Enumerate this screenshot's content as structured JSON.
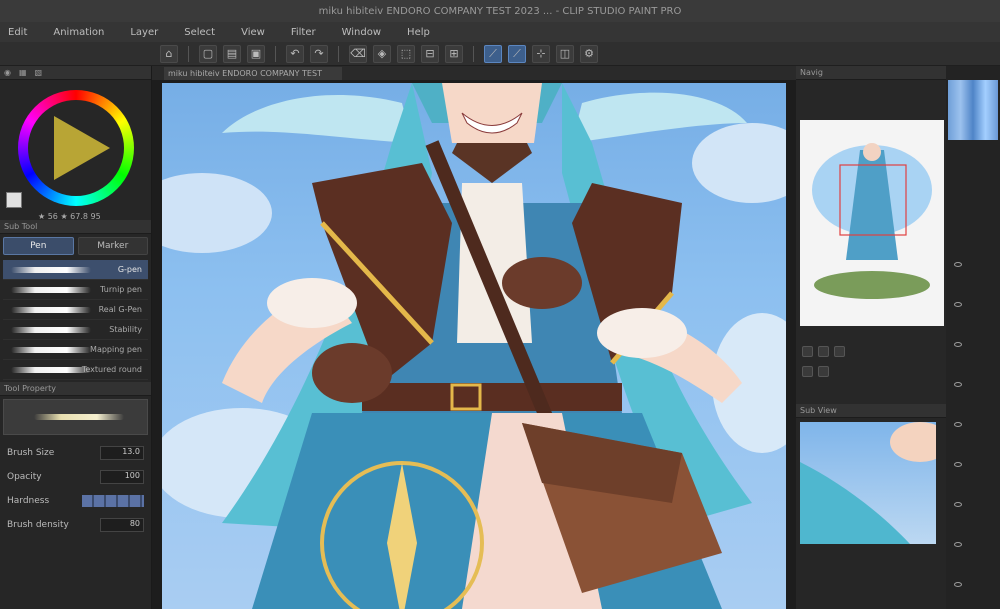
{
  "window": {
    "title": "miku hibiteiv ENDORO COMPANY TEST 2023 ... - CLIP STUDIO PAINT PRO"
  },
  "menu": [
    "Edit",
    "Animation",
    "Layer",
    "Select",
    "View",
    "Filter",
    "Window",
    "Help"
  ],
  "left_panel": {
    "color_hsv": "★ 56 ★ 67.8 95",
    "color_label": "color",
    "subtool_header": "Sub Tool",
    "tabs": {
      "pen": "Pen",
      "marker": "Marker"
    },
    "brushes": [
      "G-pen",
      "Turnip pen",
      "Real G-Pen",
      "Stability",
      "Mapping pen",
      "Textured round"
    ],
    "tool_property_header": "Tool Property",
    "properties": {
      "brush_size_label": "Brush Size",
      "brush_size_value": "13.0",
      "opacity_label": "Opacity",
      "opacity_value": "100",
      "hardness_label": "Hardness",
      "brush_density_label": "Brush density",
      "brush_density_value": "80"
    }
  },
  "canvas": {
    "tab_label": "miku hibiteiv ENDORO COMPANY TEST"
  },
  "right_panel": {
    "navigator_header": "Navig",
    "subview_header": "Sub View"
  }
}
